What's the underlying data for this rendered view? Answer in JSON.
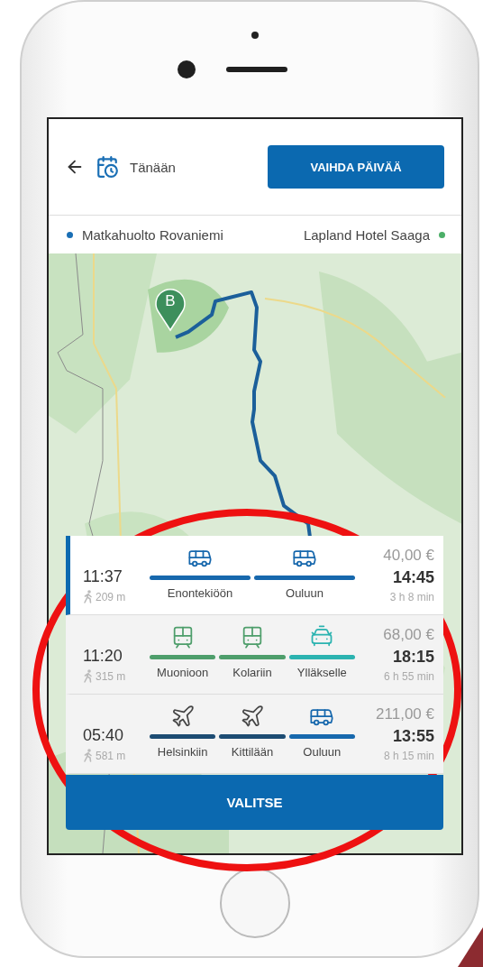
{
  "header": {
    "date_label": "Tänään",
    "change_date_button": "VAIHDA PÄIVÄÄ"
  },
  "route": {
    "origin": {
      "name": "Matkahuolto Rovaniemi",
      "color": "#1a6fb5"
    },
    "destination": {
      "name": "Lapland Hotel Saaga",
      "color": "#4caf68"
    }
  },
  "map": {
    "kind": "picture",
    "marker_label": "B"
  },
  "options": [
    {
      "selected": true,
      "departure": "11:37",
      "walk": "209 m",
      "price": "40,00 €",
      "arrival": "14:45",
      "duration": "3 h 8 min",
      "legs": [
        {
          "kind": "bus",
          "color": "#1768ad",
          "label": "Enontekiöön"
        },
        {
          "kind": "bus",
          "color": "#1768ad",
          "label": "Ouluun"
        }
      ]
    },
    {
      "selected": false,
      "departure": "11:20",
      "walk": "315 m",
      "price": "68,00 €",
      "arrival": "18:15",
      "duration": "6 h 55 min",
      "legs": [
        {
          "kind": "train",
          "color": "#4e9e6b",
          "label": "Muonioon"
        },
        {
          "kind": "train",
          "color": "#4e9e6b",
          "label": "Kolariin"
        },
        {
          "kind": "taxi",
          "color": "#2bb3b0",
          "label": "Ylläkselle"
        }
      ]
    },
    {
      "selected": false,
      "departure": "05:40",
      "walk": "581 m",
      "price": "211,00 €",
      "arrival": "13:55",
      "duration": "8 h 15 min",
      "legs": [
        {
          "kind": "plane",
          "color": "#1d4c73",
          "label": "Helsinkiin"
        },
        {
          "kind": "plane",
          "color": "#1d4c73",
          "label": "Kittilään"
        },
        {
          "kind": "bus",
          "color": "#1768ad",
          "label": "Ouluun"
        }
      ]
    }
  ],
  "select_button": "VALITSE"
}
